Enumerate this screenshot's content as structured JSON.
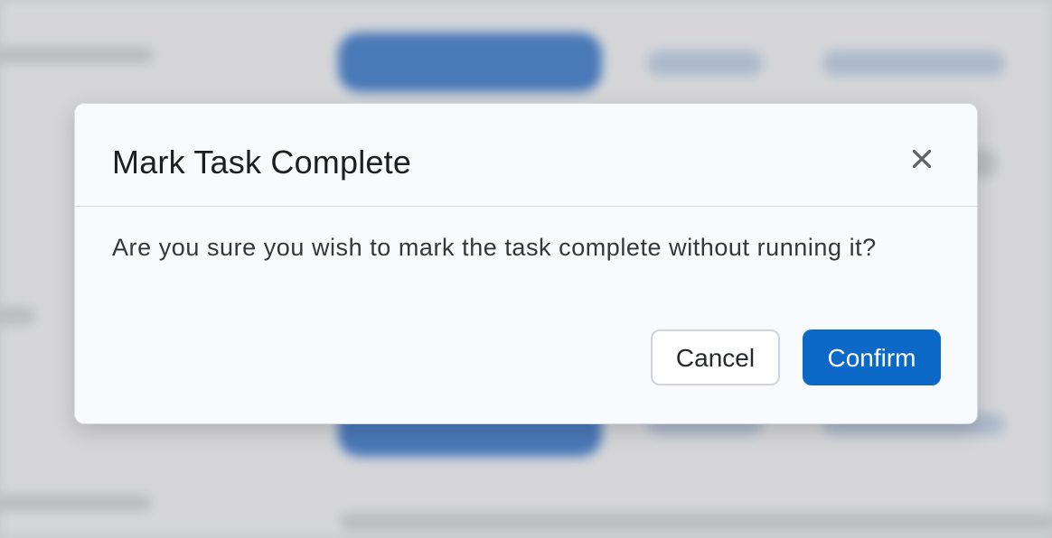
{
  "modal": {
    "title": "Mark Task Complete",
    "message": "Are you sure you wish to mark the task complete without running it?",
    "close_icon": "close-icon",
    "cancel_label": "Cancel",
    "confirm_label": "Confirm"
  },
  "colors": {
    "primary": "#0d69c8",
    "modal_background": "#f8fafd",
    "border": "#d7dbe2",
    "text": "#1b1f24"
  }
}
